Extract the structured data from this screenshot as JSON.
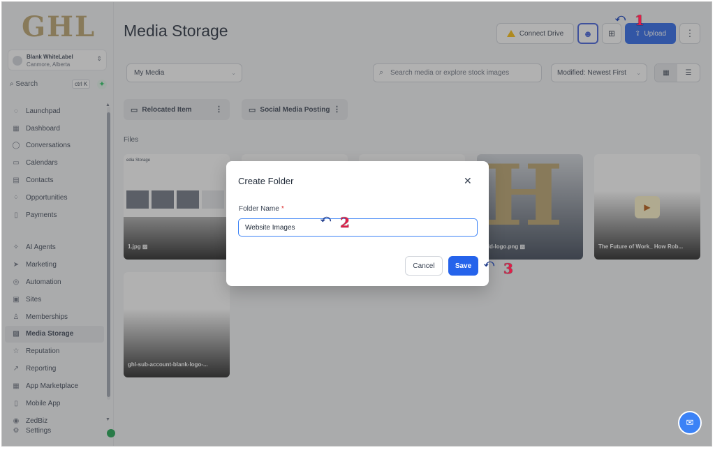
{
  "brand": {
    "logo": "GHL"
  },
  "account": {
    "name": "Blank WhiteLabel",
    "location": "Canmore, Alberta"
  },
  "sidebar_search": {
    "label": "Search",
    "shortcut": "ctrl K"
  },
  "nav": {
    "group1": [
      {
        "label": "Launchpad",
        "icon": "rocket-icon"
      },
      {
        "label": "Dashboard",
        "icon": "grid-icon"
      },
      {
        "label": "Conversations",
        "icon": "chat-icon"
      },
      {
        "label": "Calendars",
        "icon": "calendar-icon"
      },
      {
        "label": "Contacts",
        "icon": "contacts-icon"
      },
      {
        "label": "Opportunities",
        "icon": "opportunities-icon"
      },
      {
        "label": "Payments",
        "icon": "payments-icon"
      }
    ],
    "group2": [
      {
        "label": "AI Agents",
        "icon": "sparkle-icon"
      },
      {
        "label": "Marketing",
        "icon": "send-icon"
      },
      {
        "label": "Automation",
        "icon": "automation-icon"
      },
      {
        "label": "Sites",
        "icon": "sites-icon"
      },
      {
        "label": "Memberships",
        "icon": "membership-icon"
      },
      {
        "label": "Media Storage",
        "icon": "image-icon"
      },
      {
        "label": "Reputation",
        "icon": "star-icon"
      },
      {
        "label": "Reporting",
        "icon": "chart-icon"
      },
      {
        "label": "App Marketplace",
        "icon": "apps-icon"
      },
      {
        "label": "Mobile App",
        "icon": "mobile-icon"
      }
    ],
    "bottom": [
      {
        "label": "ZedBiz",
        "icon": "zedbiz-icon"
      },
      {
        "label": "Settings",
        "icon": "settings-icon"
      }
    ]
  },
  "header": {
    "title": "Media Storage",
    "connect_drive": "Connect Drive",
    "upload": "Upload"
  },
  "toolbar": {
    "source": "My Media",
    "search_placeholder": "Search media or explore stock images",
    "sort": "Modified: Newest First"
  },
  "folders": [
    {
      "name": "Relocated Item"
    },
    {
      "name": "Social Media Posting"
    }
  ],
  "files_label": "Files",
  "files": [
    {
      "caption": "1.jpg",
      "type": "image"
    },
    {
      "caption": "gold-logo.png",
      "type": "image"
    },
    {
      "caption": "The Future of Work_ How Rob...",
      "type": "video"
    },
    {
      "caption": "ghl-sub-account-blank-logo-...",
      "type": "image"
    }
  ],
  "thumb_text": {
    "title": "edia Storage",
    "letter": "H"
  },
  "modal": {
    "title": "Create Folder",
    "field_label": "Folder Name",
    "required_mark": "*",
    "field_value": "Website Images",
    "cancel": "Cancel",
    "save": "Save"
  },
  "steps": [
    "1",
    "2",
    "3"
  ],
  "colors": {
    "primary": "#2563eb",
    "brand_gold": "#b8a06a",
    "step_marker": "#e11d48"
  }
}
